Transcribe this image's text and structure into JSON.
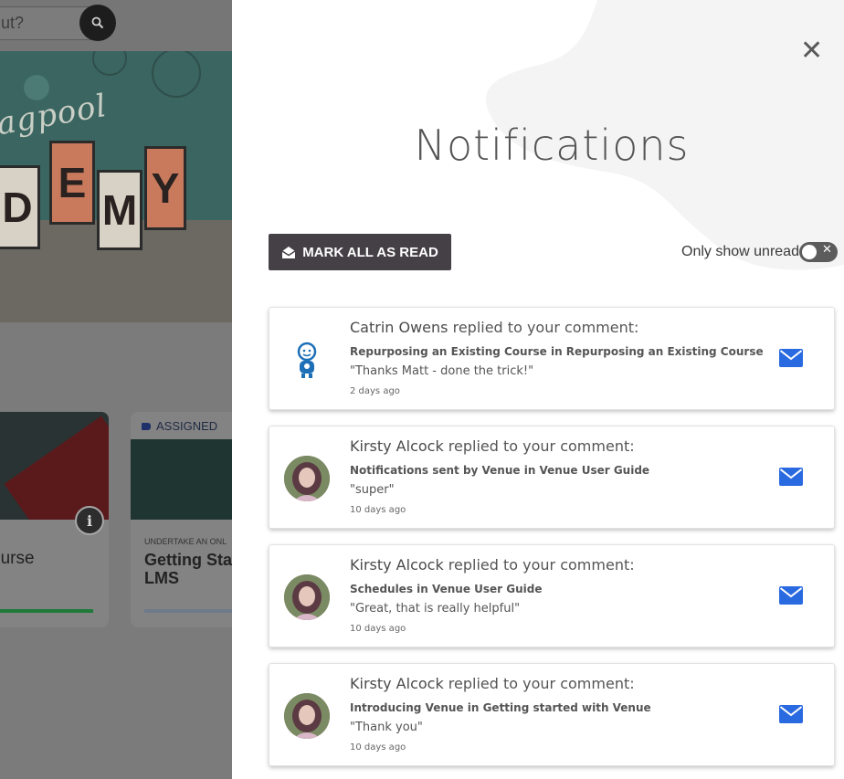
{
  "background": {
    "search_text": "ut?",
    "hero_text": "agpool",
    "hero_letters": [
      "D",
      "E",
      "M",
      "Y"
    ],
    "card1_title": "ourse",
    "card2_badge": "ASSIGNED",
    "card2_overline": "UNDERTAKE AN ONL",
    "card2_title_line1": "Getting Star",
    "card2_title_line2": "LMS",
    "info_glyph": "i"
  },
  "panel": {
    "title": "Notifications",
    "close_glyph": "✕",
    "mark_all_label": "MARK ALL AS READ",
    "only_unread_label": "Only show unread",
    "toggle_off_glyph": "✕",
    "only_unread": false
  },
  "notifications": [
    {
      "author": "Catrin Owens",
      "action": " replied to your comment:",
      "course": "Repurposing an Existing Course in Repurposing an Existing Course",
      "quote": "\"Thanks Matt - done the trick!\"",
      "time": "2 days ago",
      "avatar": "robot-mascot"
    },
    {
      "author": "Kirsty Alcock",
      "action": " replied to your comment:",
      "course": "Notifications sent by Venue in Venue User Guide",
      "quote": "\"super\"",
      "time": "10 days ago",
      "avatar": "photo"
    },
    {
      "author": "Kirsty Alcock",
      "action": " replied to your comment:",
      "course": "Schedules in Venue User Guide",
      "quote": "\"Great, that is really helpful\"",
      "time": "10 days ago",
      "avatar": "photo"
    },
    {
      "author": "Kirsty Alcock",
      "action": " replied to your comment:",
      "course": "Introducing Venue in Getting started with Venue",
      "quote": "\"Thank you\"",
      "time": "10 days ago",
      "avatar": "photo"
    }
  ],
  "colors": {
    "mail_icon": "#2a6ae0",
    "mark_button_bg": "#454045",
    "accent_green": "#1f7a3a"
  }
}
